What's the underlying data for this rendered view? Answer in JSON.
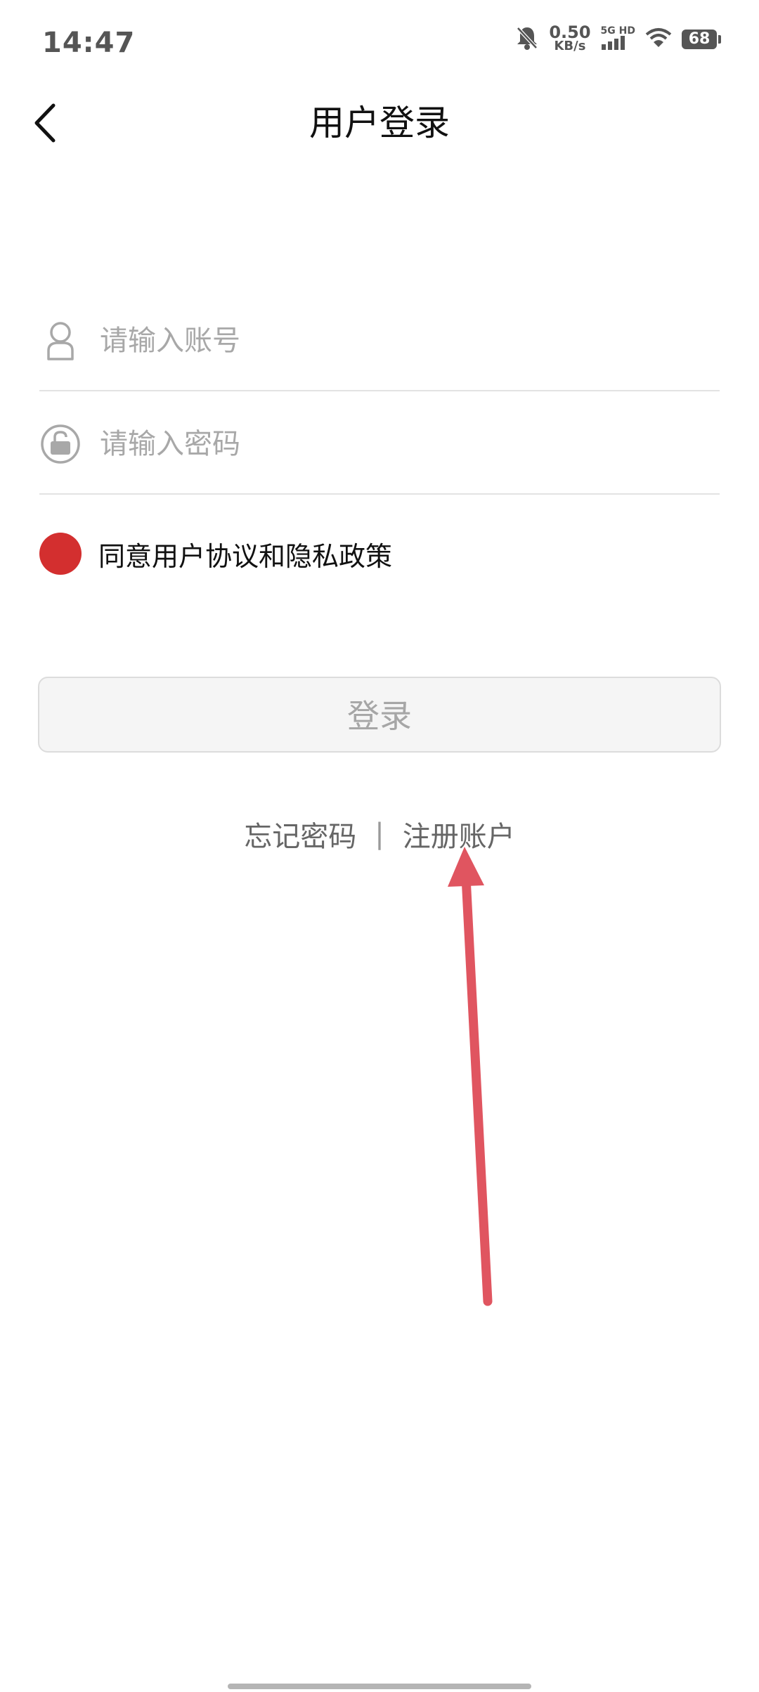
{
  "status_bar": {
    "time": "14:47",
    "net_speed_value": "0.50",
    "net_speed_unit": "KB/s",
    "signal_label": "5G HD",
    "battery": "68"
  },
  "header": {
    "title": "用户登录"
  },
  "form": {
    "account_placeholder": "请输入账号",
    "password_placeholder": "请输入密码",
    "agreement_text": "同意用户协议和隐私政策"
  },
  "login_button": {
    "label": "登录"
  },
  "links": {
    "forgot_password": "忘记密码",
    "separator": "|",
    "register": "注册账户"
  },
  "colors": {
    "accent_red": "#d32f2f",
    "annotation_arrow": "#e05560"
  }
}
